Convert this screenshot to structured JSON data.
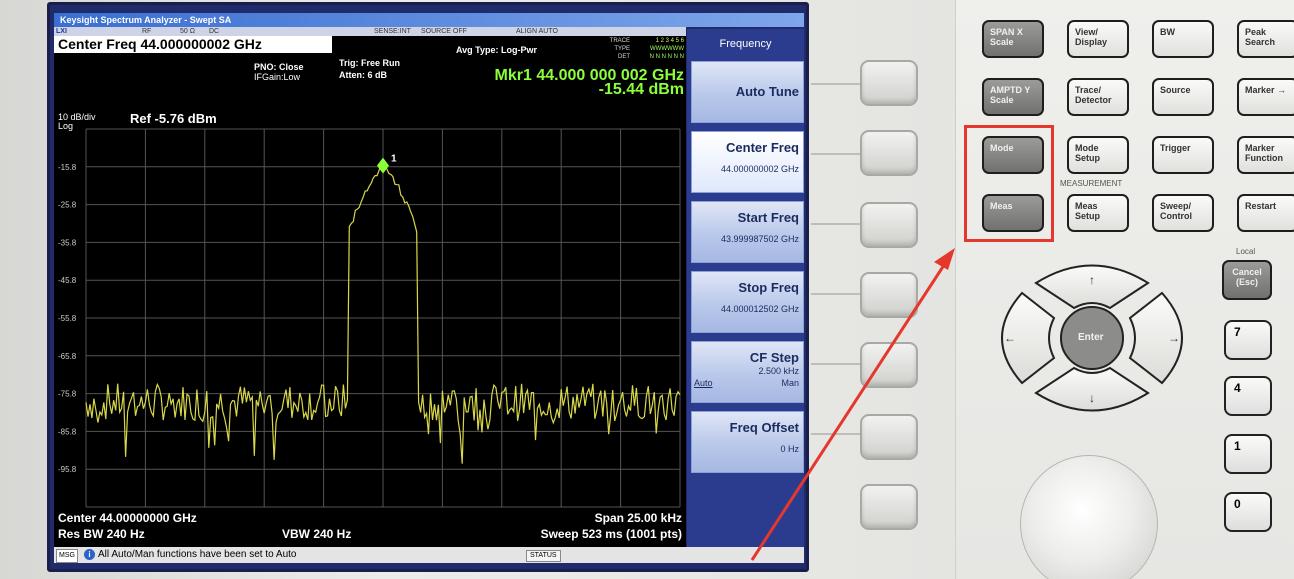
{
  "screen": {
    "title": "Keysight Spectrum Analyzer - Swept SA",
    "topstrip": {
      "xi": "LXI",
      "rf": "RF",
      "imp": "50 Ω",
      "dc": "DC",
      "sense": "SENSE:INT",
      "source": "SOURCE OFF",
      "align": "ALIGN AUTO"
    },
    "center_freq_box": "Center Freq 44.000000002 GHz",
    "pno": "PNO: Close",
    "ifgain": "IFGain:Low",
    "trig": "Trig: Free Run",
    "atten": "Atten: 6 dB",
    "avg_type": "Avg Type: Log-Pwr",
    "trace_labels": {
      "trace": "TRACE",
      "type": "TYPE",
      "det": "DET",
      "trace_nums": "1 2 3 4 5 6",
      "type_vals": "WWWWWW",
      "det_vals": "N N N N N N"
    },
    "marker": {
      "freq": "Mkr1 44.000 000 002 GHz",
      "level": "-15.44 dBm",
      "id": "1"
    },
    "scale_div": "10 dB/div",
    "log": "Log",
    "ref": "Ref -5.76 dBm",
    "y_ticks": [
      "-15.8",
      "-25.8",
      "-35.8",
      "-45.8",
      "-55.8",
      "-65.8",
      "-75.8",
      "-85.8",
      "-95.8"
    ],
    "bottom": {
      "center": "Center 44.00000000 GHz",
      "rbw": "Res BW 240 Hz",
      "vbw": "VBW 240 Hz",
      "span": "Span 25.00 kHz",
      "sweep": "Sweep  523 ms (1001 pts)"
    },
    "status": {
      "msg": "MSG",
      "info": "i",
      "text": "All Auto/Man functions have been set to Auto",
      "status_label": "STATUS"
    },
    "colors": {
      "trace": "#d8d84a",
      "marker": "#8aff3c",
      "grid": "#555555",
      "softkey_bg": "#2b3c8f"
    }
  },
  "softmenu": {
    "title": "Frequency",
    "keys": [
      {
        "label": "Auto Tune",
        "sub": ""
      },
      {
        "label": "Center Freq",
        "sub": "44.000000002 GHz"
      },
      {
        "label": "Start Freq",
        "sub": "43.999987502 GHz"
      },
      {
        "label": "Stop Freq",
        "sub": "44.000012502 GHz"
      },
      {
        "label": "CF Step",
        "sub": "2.500 kHz",
        "auto": "Auto",
        "man": "Man"
      },
      {
        "label": "Freq Offset",
        "sub": "0 Hz"
      }
    ]
  },
  "front_panel": {
    "row1": [
      "SPAN X Scale",
      "View/ Display",
      "BW",
      "Peak Search"
    ],
    "row2": [
      "AMPTD Y Scale",
      "Trace/ Detector",
      "Source",
      "Marker →"
    ],
    "row3": [
      "Mode",
      "Mode Setup",
      "Trigger",
      "Marker Function"
    ],
    "measurement_label": "MEASUREMENT",
    "row4": [
      "Meas",
      "Meas Setup",
      "Sweep/ Control",
      "Restart"
    ],
    "local": "Local",
    "cancel": "Cancel (Esc)",
    "enter": "Enter",
    "num_keys": [
      "7",
      "4",
      "1",
      "0"
    ]
  }
}
